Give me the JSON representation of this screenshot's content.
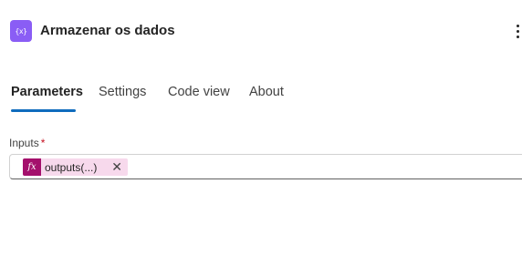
{
  "header": {
    "icon_glyph": "{x}",
    "icon_name": "variable-icon",
    "title": "Armazenar os dados",
    "accent_color": "#8a5df5"
  },
  "tabs": [
    {
      "label": "Parameters",
      "active": true
    },
    {
      "label": "Settings",
      "active": false
    },
    {
      "label": "Code view",
      "active": false
    },
    {
      "label": "About",
      "active": false
    }
  ],
  "inputs_field": {
    "label": "Inputs",
    "required_marker": "*",
    "token": {
      "icon_glyph": "fx",
      "text": "outputs(...)",
      "remove_glyph": "✕",
      "token_color": "#a4106c"
    }
  }
}
